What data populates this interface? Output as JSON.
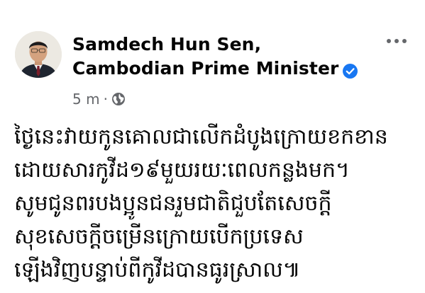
{
  "post": {
    "author_line1": "Samdech Hun Sen,",
    "author_line2": "Cambodian Prime Minister",
    "verified_icon": "verified-badge-icon",
    "timestamp": "5 m",
    "separator": "·",
    "privacy_icon": "globe-icon",
    "more_icon": "more-options-icon",
    "text_lines": [
      "ថ្ងៃនេះវាយកូនគោលជាលើកដំបូងក្រោយខកខាន",
      "ដោយសារកូវីដ១៩មួយរយៈពេលកន្លងមក។",
      "សូមជូនពរបងប្អូនជនរួមជាតិជួបតែសេចក្តី",
      "សុខសេចក្តីចម្រើនក្រោយបើកប្រទេស",
      "ឡើងវិញបន្ទាប់ពីកូវីដបានធូរស្រាល៕"
    ]
  },
  "colors": {
    "text": "#050505",
    "secondary": "#65676b",
    "verified": "#1877f2",
    "background": "#ffffff"
  }
}
